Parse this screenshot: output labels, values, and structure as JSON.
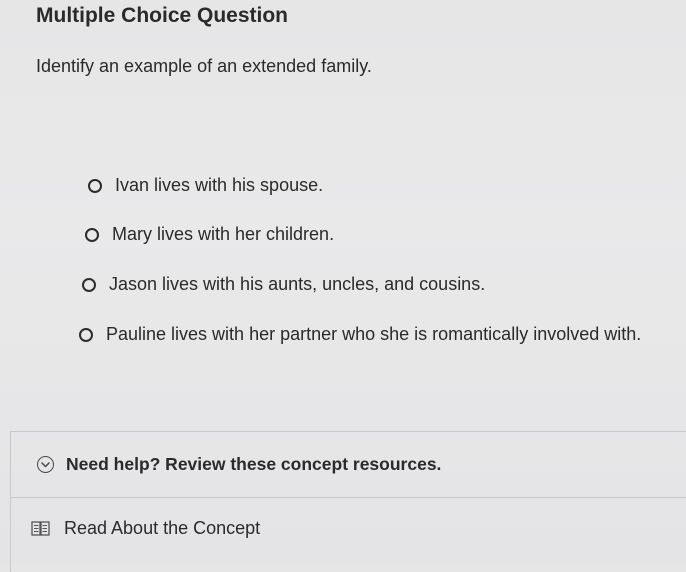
{
  "question": {
    "header": "Multiple Choice Question",
    "prompt": "Identify an example of an extended family."
  },
  "options": [
    {
      "label": "Ivan lives with his spouse.",
      "selected": false
    },
    {
      "label": "Mary lives with her children.",
      "selected": false
    },
    {
      "label": "Jason lives with his aunts, uncles, and cousins.",
      "selected": false
    },
    {
      "label": "Pauline lives with her partner who she is romantically involved with.",
      "selected": false
    }
  ],
  "help": {
    "toggle_icon": "chevron-down-circle-icon",
    "title": "Need help? Review these concept resources.",
    "resources": [
      {
        "icon": "book-icon",
        "label": "Read About the Concept"
      }
    ]
  }
}
